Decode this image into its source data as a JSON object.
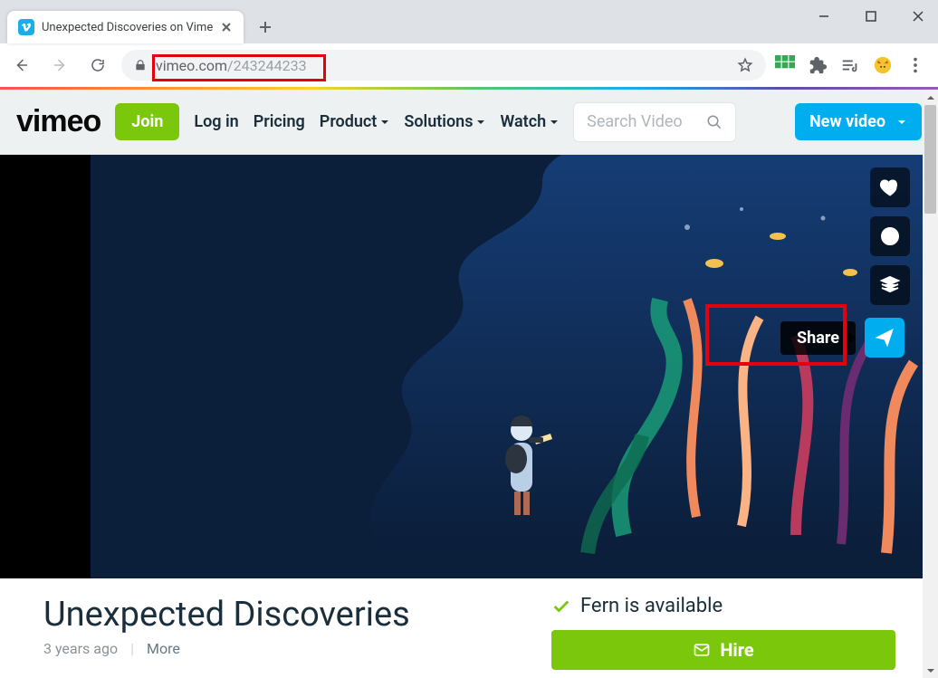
{
  "browser": {
    "tab_title": "Unexpected Discoveries on Vime",
    "url_host": "vimeo.com",
    "url_path": "/243244233"
  },
  "vimeo_nav": {
    "logo": "vimeo",
    "join": "Join",
    "login": "Log in",
    "pricing": "Pricing",
    "product": "Product",
    "solutions": "Solutions",
    "watch": "Watch",
    "search_placeholder": "Search Video",
    "new_video": "New video"
  },
  "video": {
    "share_tooltip": "Share",
    "title": "Unexpected Discoveries",
    "posted": "3 years ago",
    "more": "More"
  },
  "sidebar": {
    "available_text": "Fern is available",
    "hire_label": "Hire"
  }
}
